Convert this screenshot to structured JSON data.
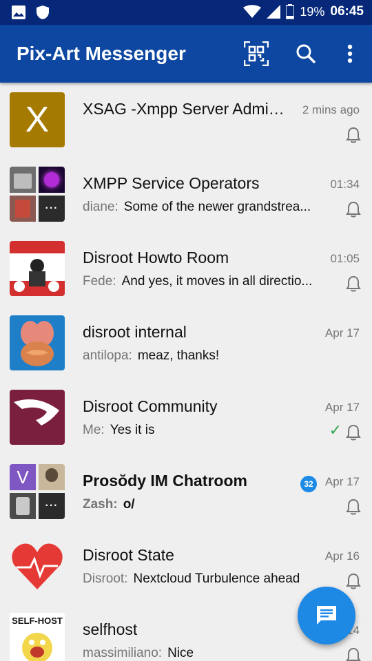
{
  "status_bar": {
    "battery": "19%",
    "time": "06:45"
  },
  "app_bar": {
    "title": "Pix-Art Messenger"
  },
  "conversations": [
    {
      "name": "XSAG -Xmpp Server Admin...",
      "time": "2 mins ago",
      "sender": "",
      "message": "",
      "avatar_letter": "X",
      "avatar_color": "#a57a00"
    },
    {
      "name": "XMPP Service Operators",
      "time": "01:34",
      "sender": "diane:",
      "message": "Some of the newer grandstrea..."
    },
    {
      "name": "Disroot Howto Room",
      "time": "01:05",
      "sender": "Fede:",
      "message": "And yes, it moves in all directio..."
    },
    {
      "name": "disroot internal",
      "time": "Apr 17",
      "sender": "antilopa:",
      "message": "meaz, thanks!"
    },
    {
      "name": "Disroot Community",
      "time": "Apr 17",
      "sender": "Me:",
      "message": "Yes it is"
    },
    {
      "name": "Prosŏdy IM Chatroom",
      "time": "Apr 17",
      "sender": "Zash:",
      "message": "o/",
      "unread": "32",
      "avatar_letter": "V"
    },
    {
      "name": "Disroot State",
      "time": "Apr 16",
      "sender": "Disroot:",
      "message": "Nextcloud Turbulence ahead"
    },
    {
      "name": "selfhost",
      "time": "Apr 14",
      "sender": "massimiliano:",
      "message": "Nice",
      "avatar_text": "SELF-HOST"
    }
  ],
  "more_tile": "···",
  "colors": {
    "primary": "#0d47a1",
    "status_bar": "#072879",
    "fab": "#1e88e5",
    "badge": "#1d8be6",
    "check": "#34a853"
  }
}
